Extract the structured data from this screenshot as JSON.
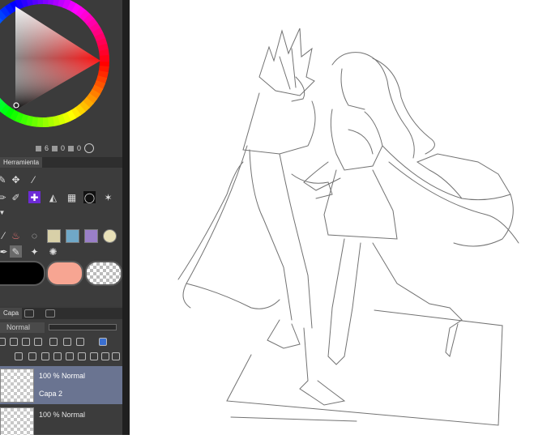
{
  "colors": {
    "panel": "#3a3a3a",
    "selected_tool": "#6d2bd6",
    "selected_layer": "#6a7491",
    "fg_color": "#000000",
    "bg_color": "#f7a592"
  },
  "color_status": {
    "value_1": "6",
    "value_2": "0",
    "value_3": "0"
  },
  "tool_panel": {
    "tab_label": "Herramienta"
  },
  "layer_panel": {
    "tab_label": "Capa",
    "blend_mode": "Normal",
    "layers": [
      {
        "mode": "100 % Normal",
        "name": "Capa 2",
        "selected": true
      },
      {
        "mode": "100 % Normal",
        "name": "",
        "selected": false
      }
    ]
  }
}
